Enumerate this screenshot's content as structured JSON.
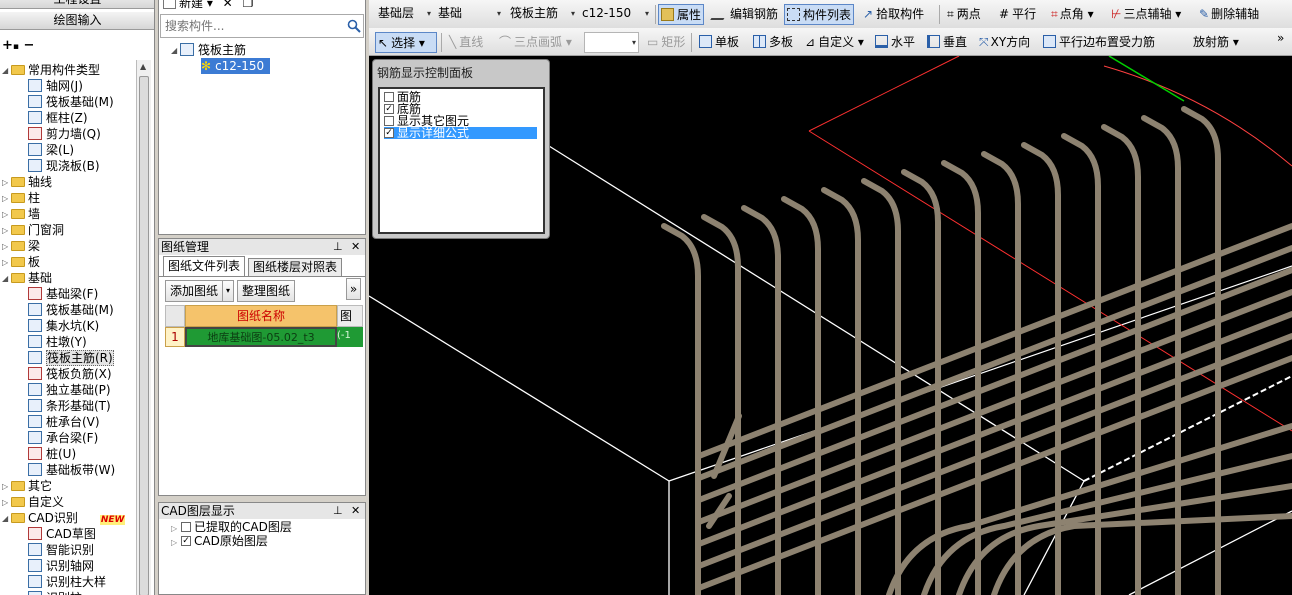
{
  "left_panel": {
    "top_title": "工程设置",
    "draw_input": "绘图输入",
    "tree": [
      {
        "label": "常用构件类型",
        "type": "folder",
        "expanded": true,
        "level": 0
      },
      {
        "label": "轴网(J)",
        "type": "item",
        "icon": "axis-grid-icon",
        "level": 1
      },
      {
        "label": "筏板基础(M)",
        "type": "item",
        "icon": "raft-foundation-icon",
        "level": 1
      },
      {
        "label": "框柱(Z)",
        "type": "item",
        "icon": "frame-column-icon",
        "level": 1
      },
      {
        "label": "剪力墙(Q)",
        "type": "item",
        "icon": "shear-wall-icon",
        "level": 1
      },
      {
        "label": "梁(L)",
        "type": "item",
        "icon": "beam-icon",
        "level": 1
      },
      {
        "label": "现浇板(B)",
        "type": "item",
        "icon": "cast-slab-icon",
        "level": 1
      },
      {
        "label": "轴线",
        "type": "folder",
        "expanded": false,
        "level": 0
      },
      {
        "label": "柱",
        "type": "folder",
        "expanded": false,
        "level": 0
      },
      {
        "label": "墙",
        "type": "folder",
        "expanded": false,
        "level": 0
      },
      {
        "label": "门窗洞",
        "type": "folder",
        "expanded": false,
        "level": 0
      },
      {
        "label": "梁",
        "type": "folder",
        "expanded": false,
        "level": 0
      },
      {
        "label": "板",
        "type": "folder",
        "expanded": false,
        "level": 0
      },
      {
        "label": "基础",
        "type": "folder",
        "expanded": true,
        "level": 0
      },
      {
        "label": "基础梁(F)",
        "type": "item",
        "icon": "foundation-beam-icon",
        "level": 1
      },
      {
        "label": "筏板基础(M)",
        "type": "item",
        "icon": "raft-foundation-icon",
        "level": 1
      },
      {
        "label": "集水坑(K)",
        "type": "item",
        "icon": "sump-pit-icon",
        "level": 1
      },
      {
        "label": "柱墩(Y)",
        "type": "item",
        "icon": "column-pier-icon",
        "level": 1
      },
      {
        "label": "筏板主筋(R)",
        "type": "item",
        "icon": "raft-main-rebar-icon",
        "level": 1,
        "selected": true
      },
      {
        "label": "筏板负筋(X)",
        "type": "item",
        "icon": "raft-negative-rebar-icon",
        "level": 1
      },
      {
        "label": "独立基础(P)",
        "type": "item",
        "icon": "isolated-footing-icon",
        "level": 1
      },
      {
        "label": "条形基础(T)",
        "type": "item",
        "icon": "strip-footing-icon",
        "level": 1
      },
      {
        "label": "桩承台(V)",
        "type": "item",
        "icon": "pile-cap-icon",
        "level": 1
      },
      {
        "label": "承台梁(F)",
        "type": "item",
        "icon": "cap-beam-icon",
        "level": 1
      },
      {
        "label": "桩(U)",
        "type": "item",
        "icon": "pile-icon",
        "level": 1
      },
      {
        "label": "基础板带(W)",
        "type": "item",
        "icon": "foundation-strip-icon",
        "level": 1
      },
      {
        "label": "其它",
        "type": "folder",
        "expanded": false,
        "level": 0
      },
      {
        "label": "自定义",
        "type": "folder",
        "expanded": false,
        "level": 0
      },
      {
        "label": "CAD识别",
        "type": "folder",
        "expanded": true,
        "level": 0,
        "badge": "NEW"
      },
      {
        "label": "CAD草图",
        "type": "item",
        "icon": "cad-sketch-icon",
        "level": 1
      },
      {
        "label": "智能识别",
        "type": "item",
        "icon": "smart-recognize-icon",
        "level": 1
      },
      {
        "label": "识别轴网",
        "type": "item",
        "icon": "recognize-axis-icon",
        "level": 1
      },
      {
        "label": "识别柱大样",
        "type": "item",
        "icon": "recognize-column-detail-icon",
        "level": 1
      },
      {
        "label": "识别柱",
        "type": "item",
        "icon": "recognize-column-icon",
        "level": 1
      }
    ]
  },
  "component_panel": {
    "new_label": "新建",
    "search_placeholder": "搜索构件...",
    "tree_root": "筏板主筋",
    "tree_child": "c12-150"
  },
  "drawing_panel": {
    "title": "图纸管理",
    "tabs": [
      "图纸文件列表",
      "图纸楼层对照表"
    ],
    "add_label": "添加图纸",
    "organize_label": "整理图纸",
    "more": "»",
    "columns": [
      "图纸名称",
      "图纸"
    ],
    "rows": [
      {
        "index": "1",
        "name": "地库基础图-05.02_t3",
        "extra": "(-1"
      }
    ]
  },
  "cad_panel": {
    "title": "CAD图层显示",
    "layers": [
      {
        "label": "已提取的CAD图层",
        "checked": false
      },
      {
        "label": "CAD原始图层",
        "checked": true
      }
    ]
  },
  "toolbar1": {
    "floor": "基础层",
    "category": "基础",
    "component_type": "筏板主筋",
    "component_name": "c12-150",
    "properties": "属性",
    "edit_rebar": "编辑钢筋",
    "component_list": "构件列表",
    "pick_component": "拾取构件",
    "two_points": "两点",
    "parallel": "平行",
    "point_angle": "点角",
    "three_point_axis": "三点辅轴",
    "delete_axis": "删除辅轴"
  },
  "toolbar2": {
    "select": "选择",
    "line": "直线",
    "arc": "三点画弧",
    "rect": "矩形",
    "single_slab": "单板",
    "multi_slab": "多板",
    "custom": "自定义",
    "horizontal": "水平",
    "vertical": "垂直",
    "xy_direction": "XY方向",
    "parallel_edge": "平行边布置受力筋",
    "radial": "放射筋",
    "more": "»"
  },
  "rebar_dialog": {
    "title": "钢筋显示控制面板",
    "options": [
      {
        "label": "面筋",
        "checked": false
      },
      {
        "label": "底筋",
        "checked": true
      },
      {
        "label": "显示其它图元",
        "checked": false
      },
      {
        "label": "显示详细公式",
        "checked": true,
        "highlighted": true
      }
    ]
  },
  "colors": {
    "canvas_bg": "#000000",
    "rebar": "#8d8270",
    "selected_row": "#1f9a34",
    "header_row": "#f5c36b",
    "highlight": "#3399ff"
  }
}
